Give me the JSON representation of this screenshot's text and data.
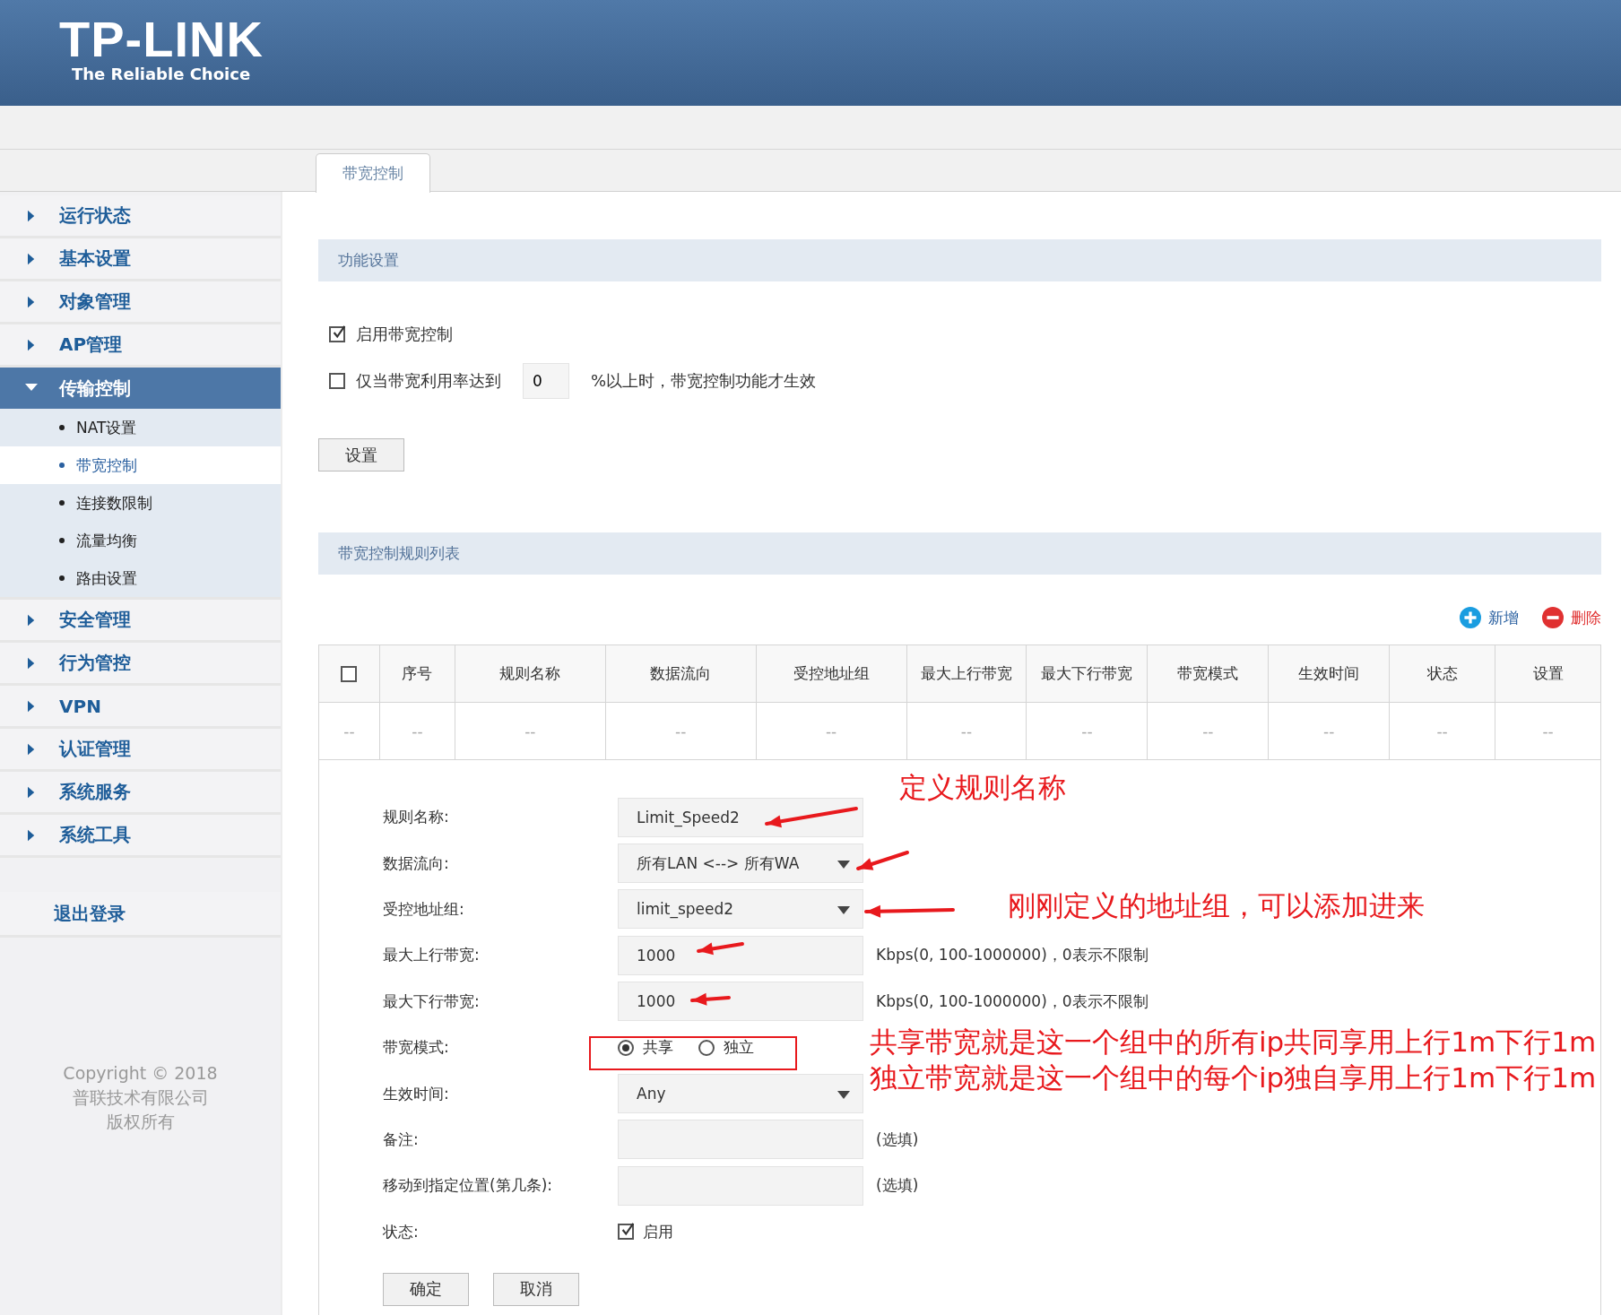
{
  "header": {
    "logo": "TP-LINK",
    "tagline": "The Reliable Choice"
  },
  "tabs": [
    {
      "label": "带宽控制",
      "selected": true
    }
  ],
  "sidebar": {
    "items": [
      {
        "label": "运行状态",
        "expanded": false
      },
      {
        "label": "基本设置",
        "expanded": false
      },
      {
        "label": "对象管理",
        "expanded": false
      },
      {
        "label": "AP管理",
        "expanded": false
      },
      {
        "label": "传输控制",
        "expanded": true,
        "children": [
          {
            "label": "NAT设置",
            "selected": false
          },
          {
            "label": "带宽控制",
            "selected": true
          },
          {
            "label": "连接数限制",
            "selected": false
          },
          {
            "label": "流量均衡",
            "selected": false
          },
          {
            "label": "路由设置",
            "selected": false
          }
        ]
      },
      {
        "label": "安全管理",
        "expanded": false
      },
      {
        "label": "行为管控",
        "expanded": false
      },
      {
        "label": "VPN",
        "expanded": false
      },
      {
        "label": "认证管理",
        "expanded": false
      },
      {
        "label": "系统服务",
        "expanded": false
      },
      {
        "label": "系统工具",
        "expanded": false
      }
    ],
    "logout": "退出登录",
    "copyright": [
      "Copyright © 2018",
      "普联技术有限公司",
      "版权所有"
    ]
  },
  "function_settings": {
    "title": "功能设置",
    "enable": {
      "label": "启用带宽控制",
      "checked": true
    },
    "threshold": {
      "label": "仅当带宽利用率达到",
      "checked": false,
      "value": "0",
      "suffix": "%以上时，带宽控制功能才生效"
    },
    "button": "设置"
  },
  "rule_list": {
    "title": "带宽控制规则列表",
    "actions": [
      {
        "kind": "add",
        "label": "新增"
      },
      {
        "kind": "delete",
        "label": "删除"
      }
    ],
    "header_checkbox": {
      "checked": false
    },
    "columns": [
      "序号",
      "规则名称",
      "数据流向",
      "受控地址组",
      "最大上行带宽",
      "最大下行带宽",
      "带宽模式",
      "生效时间",
      "状态",
      "设置"
    ],
    "rows": [
      {
        "select": "--",
        "cells": [
          "--",
          "--",
          "--",
          "--",
          "--",
          "--",
          "--",
          "--",
          "--",
          "--"
        ]
      }
    ]
  },
  "form": {
    "fields": [
      {
        "kind": "text",
        "label": "规则名称:",
        "value": "Limit_Speed2"
      },
      {
        "kind": "select",
        "label": "数据流向:",
        "value": "所有LAN <--> 所有WA"
      },
      {
        "kind": "select",
        "label": "受控地址组:",
        "value": "limit_speed2"
      },
      {
        "kind": "text",
        "label": "最大上行带宽:",
        "value": "1000",
        "hint": "Kbps(0, 100-1000000)，0表示不限制"
      },
      {
        "kind": "text",
        "label": "最大下行带宽:",
        "value": "1000",
        "hint": "Kbps(0, 100-1000000)，0表示不限制"
      },
      {
        "kind": "radio",
        "label": "带宽模式:",
        "options": [
          {
            "label": "共享",
            "selected": true
          },
          {
            "label": "独立",
            "selected": false
          }
        ]
      },
      {
        "kind": "select",
        "label": "生效时间:",
        "value": "Any"
      },
      {
        "kind": "text",
        "label": "备注:",
        "hint": "(选填)"
      },
      {
        "kind": "text",
        "label": "移动到指定位置(第几条):",
        "hint": "(选填)"
      },
      {
        "kind": "checkbox",
        "label": "状态:",
        "option": "启用",
        "checked": true
      }
    ],
    "buttons": [
      "确定",
      "取消"
    ]
  },
  "annotations": [
    {
      "text": "定义规则名称"
    },
    {
      "text": "刚刚定义的地址组，可以添加进来"
    },
    {
      "text": "共享带宽就是这一个组中的所有ip共同享用上行1m下行1m"
    },
    {
      "text": "独立带宽就是这一个组中的每个ip独自享用上行1m下行1m"
    }
  ]
}
